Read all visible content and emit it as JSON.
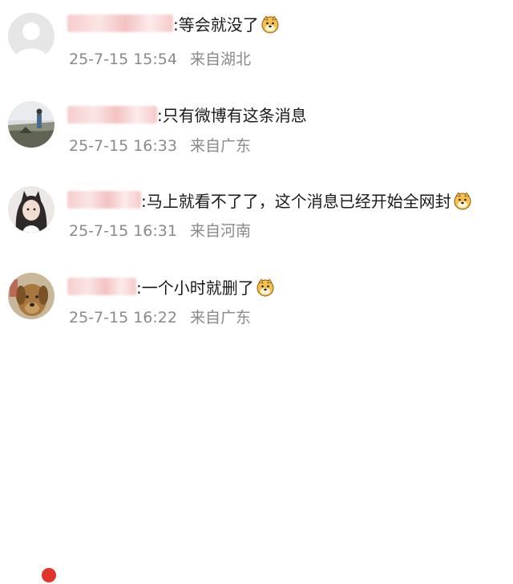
{
  "comments": [
    {
      "text": ":等会就没了",
      "date": "25-7-15",
      "time": "15:54",
      "location": "来自湖北",
      "emoji": "doge-emoji",
      "avatar": "default-avatar"
    },
    {
      "text": ":只有微博有这条消息",
      "date": "25-7-15",
      "time": "16:33",
      "location": "来自广东",
      "emoji": "",
      "avatar": "landscape-avatar"
    },
    {
      "text": ":马上就看不了了，这个消息已经开始全网封",
      "date": "25-7-15",
      "time": "16:31",
      "location": "来自河南",
      "emoji": "doge-emoji",
      "avatar": "girl-avatar"
    },
    {
      "text": ":一个小时就删了",
      "date": "25-7-15",
      "time": "16:22",
      "location": "来自广东",
      "emoji": "doge-emoji",
      "avatar": "dog-avatar"
    }
  ],
  "colors": {
    "meta_text": "#8a8a8a",
    "body_text": "#1a1a1a",
    "name_blur": "#f6c8c8",
    "badge": "#e0342a"
  }
}
